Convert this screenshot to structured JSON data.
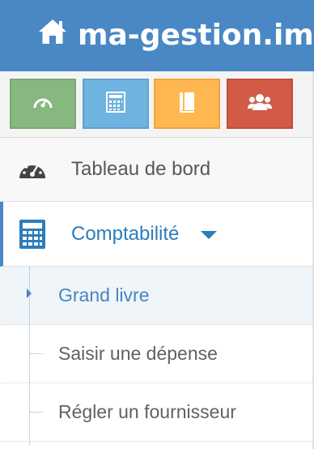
{
  "navbar": {
    "brand": "ma-gestion.imm",
    "icon": "home-icon",
    "color": "#4a88c5"
  },
  "shortcuts": [
    {
      "icon": "dashboard-gauge-icon",
      "color": "#87b87f"
    },
    {
      "icon": "calculator-icon",
      "color": "#6fb3e0"
    },
    {
      "icon": "book-icon",
      "color": "#ffb752"
    },
    {
      "icon": "users-icon",
      "color": "#d15b47"
    }
  ],
  "menu": {
    "dashboard": {
      "label": "Tableau de bord",
      "icon": "dashboard-gauge-icon"
    },
    "accounting": {
      "label": "Comptabilité",
      "icon": "calculator-icon",
      "expanded": true,
      "submenu": [
        {
          "label": "Grand livre",
          "active": true
        },
        {
          "label": "Saisir une dépense",
          "active": false
        },
        {
          "label": "Régler un fournisseur",
          "active": false
        }
      ]
    }
  }
}
